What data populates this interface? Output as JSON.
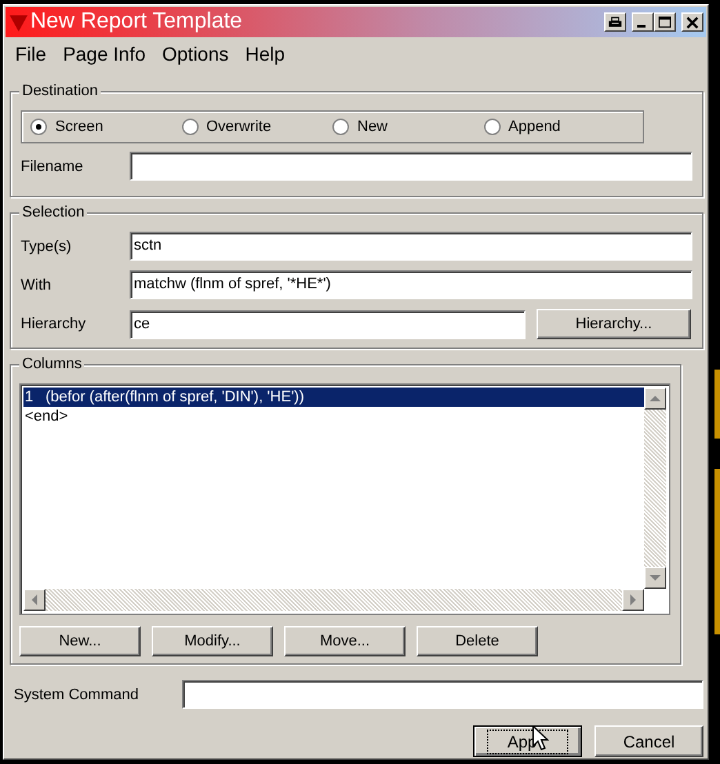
{
  "window": {
    "title": "New Report Template"
  },
  "menu": [
    "File",
    "Page Info",
    "Options",
    "Help"
  ],
  "destination": {
    "title": "Destination",
    "options": [
      {
        "label": "Screen",
        "selected": true
      },
      {
        "label": "Overwrite",
        "selected": false
      },
      {
        "label": "New",
        "selected": false
      },
      {
        "label": "Append",
        "selected": false
      }
    ],
    "filename": {
      "label": "Filename"
    }
  },
  "selection": {
    "title": "Selection",
    "fields": [
      {
        "label": "Type(s)",
        "value": "sctn"
      },
      {
        "label": "With",
        "value": "matchw (flnm of spref, '*HE*')"
      },
      {
        "label": "Hierarchy",
        "value": "ce",
        "button": "Hierarchy..."
      }
    ]
  },
  "columns": {
    "title": "Columns",
    "rows": [
      {
        "number": "1",
        "text": "(befor (after(flnm of spref, 'DIN'), 'HE'))",
        "selected": true
      },
      {
        "text": "<end>",
        "selected": false
      }
    ],
    "buttons": [
      "New...",
      "Modify...",
      "Move...",
      "Delete"
    ]
  },
  "system_command": {
    "label": "System Command"
  },
  "buttons": [
    {
      "label": "App",
      "focused": true
    },
    {
      "label": "Cancel",
      "focused": false
    }
  ]
}
